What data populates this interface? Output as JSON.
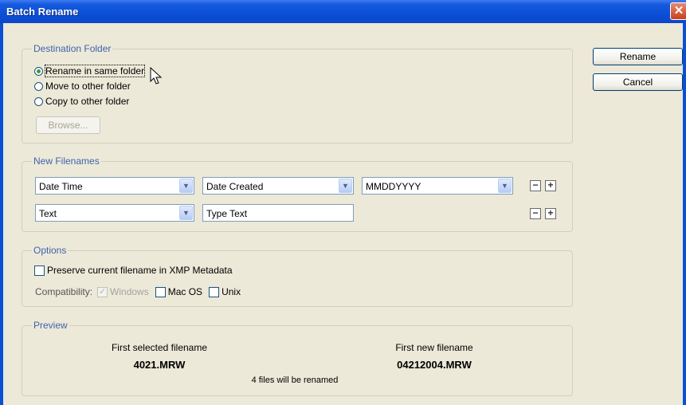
{
  "window": {
    "title": "Batch Rename",
    "close_glyph": "✕"
  },
  "buttons": {
    "rename": "Rename",
    "cancel": "Cancel"
  },
  "destination": {
    "legend": "Destination Folder",
    "options": [
      {
        "label": "Rename in same folder",
        "checked": true
      },
      {
        "label": "Move to other folder",
        "checked": false
      },
      {
        "label": "Copy to other folder",
        "checked": false
      }
    ],
    "browse_label": "Browse..."
  },
  "new_filenames": {
    "legend": "New Filenames",
    "rows": [
      {
        "fields": [
          "Date Time",
          "Date Created",
          "MMDDYYYY"
        ]
      },
      {
        "fields": [
          "Text"
        ],
        "text_input": "Type Text"
      }
    ],
    "minus": "−",
    "plus": "+"
  },
  "options": {
    "legend": "Options",
    "preserve_label": "Preserve current filename in XMP Metadata",
    "preserve_checked": false,
    "compatibility_label": "Compatibility:",
    "compat": [
      {
        "label": "Windows",
        "checked": true,
        "disabled": true
      },
      {
        "label": "Mac OS",
        "checked": false,
        "disabled": false
      },
      {
        "label": "Unix",
        "checked": false,
        "disabled": false
      }
    ]
  },
  "preview": {
    "legend": "Preview",
    "first_selected_label": "First selected filename",
    "first_selected_value": "4021.MRW",
    "first_new_label": "First new filename",
    "first_new_value": "04212004.MRW",
    "summary": "4 files will be renamed"
  },
  "icons": {
    "close": "close-icon",
    "dropdown": "chevron-down-icon",
    "cursor": "mouse-pointer-icon"
  },
  "colors": {
    "titlebar": "#0a4fd6",
    "dialog_bg": "#ece9d8",
    "legend": "#3f63ad",
    "radio_dot": "#3a9a36"
  }
}
